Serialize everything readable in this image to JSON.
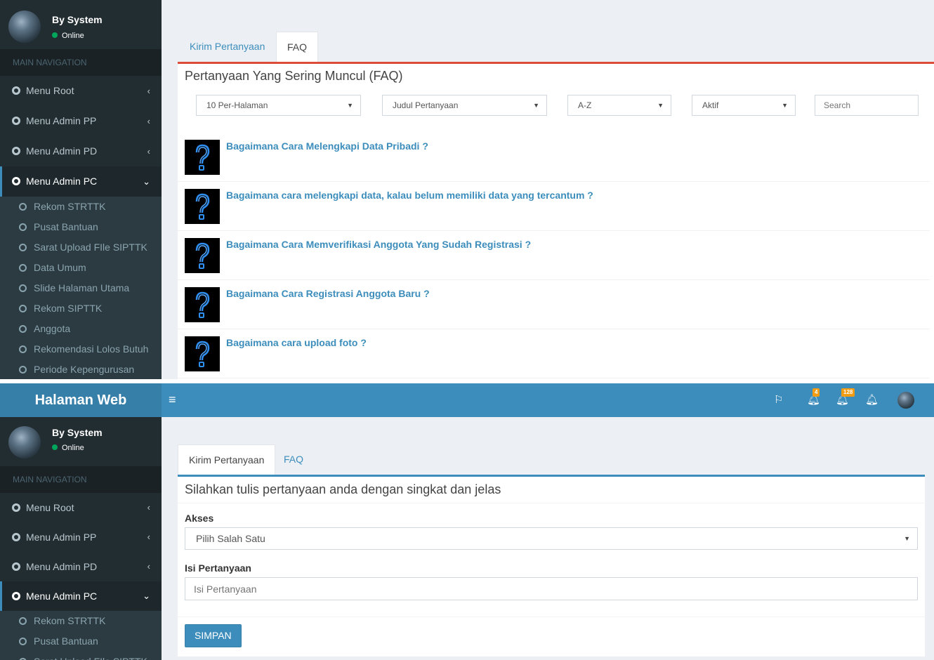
{
  "user": {
    "name": "By System",
    "status": "Online"
  },
  "nav": {
    "header": "MAIN NAVIGATION",
    "items": [
      "Menu Root",
      "Menu Admin PP",
      "Menu Admin PD",
      "Menu Admin PC"
    ],
    "sub_items": [
      "Rekom STRTTK",
      "Pusat Bantuan",
      "Sarat Upload FIle SIPTTK",
      "Data Umum",
      "Slide Halaman Utama",
      "Rekom SIPTTK",
      "Anggota",
      "Rekomendasi Lolos Butuh",
      "Periode Kepengurusan"
    ]
  },
  "header": {
    "logo": "Halaman Web",
    "badges": {
      "bell1": "4",
      "bell2": "128"
    }
  },
  "tabs": {
    "kirim": "Kirim Pertanyaan",
    "faq": "FAQ"
  },
  "faq": {
    "title": "Pertanyaan Yang Sering Muncul (FAQ)",
    "filters": {
      "per_page": "10 Per-Halaman",
      "sort_field": "Judul Pertanyaan",
      "order": "A-Z",
      "status": "Aktif",
      "search_placeholder": "Search"
    },
    "questions": [
      "Bagaimana Cara Melengkapi Data Pribadi ?",
      "Bagaimana cara melengkapi data, kalau belum memiliki data yang tercantum ?",
      "Bagaimana Cara Memverifikasi Anggota Yang Sudah Registrasi ?",
      "Bagaimana Cara Registrasi Anggota Baru ?",
      "Bagaimana cara upload foto ?"
    ]
  },
  "form": {
    "title": "Silahkan tulis pertanyaan anda dengan singkat dan jelas",
    "akses_label": "Akses",
    "akses_value": "Pilih Salah Satu",
    "isi_label": "Isi Pertanyaan",
    "isi_placeholder": "Isi Pertanyaan",
    "submit": "SIMPAN"
  },
  "colors": {
    "primary": "#3c8dbc",
    "danger": "#dd4b39",
    "sidebar": "#222d32",
    "badge": "#f39c12"
  }
}
